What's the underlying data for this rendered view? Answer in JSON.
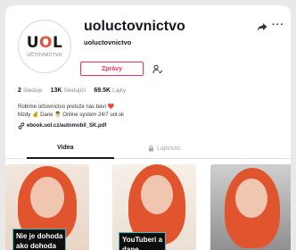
{
  "profile": {
    "username": "uoluctovnictvo",
    "nickname": "uoluctovnictvo",
    "avatar_logo_text": "UOL",
    "avatar_logo_sub": "ÚČTOVNÍCTVO"
  },
  "actions": {
    "message_label": "Zprávy"
  },
  "stats": {
    "following_count": "2",
    "following_label": "Sleduje",
    "followers_count": "13K",
    "followers_label": "Sledující",
    "likes_count": "69.5K",
    "likes_label": "Lajky"
  },
  "bio": {
    "line1": "Robíme účtovníctvo pretože nás baví ❤️",
    "line2": "Mzdy 💰 Dane 👨‍💼 Online systém 24/7 uol.sk",
    "link": "ebook.uol.cz/automobil_SK.pdf"
  },
  "tabs": {
    "videos": "Videa",
    "liked": "Lajknuto"
  },
  "videos": [
    {
      "caption_line1": "Nie je dohoda",
      "caption_line2": "ako dohoda"
    },
    {
      "caption_line1": "YouTuberi a",
      "caption_line2": "dane"
    },
    {
      "caption_line1": "",
      "caption_line2": ""
    }
  ],
  "colors": {
    "accent": "#fe2c55",
    "caption_border": "#36c1c9",
    "logo_accent": "#e8513c"
  }
}
